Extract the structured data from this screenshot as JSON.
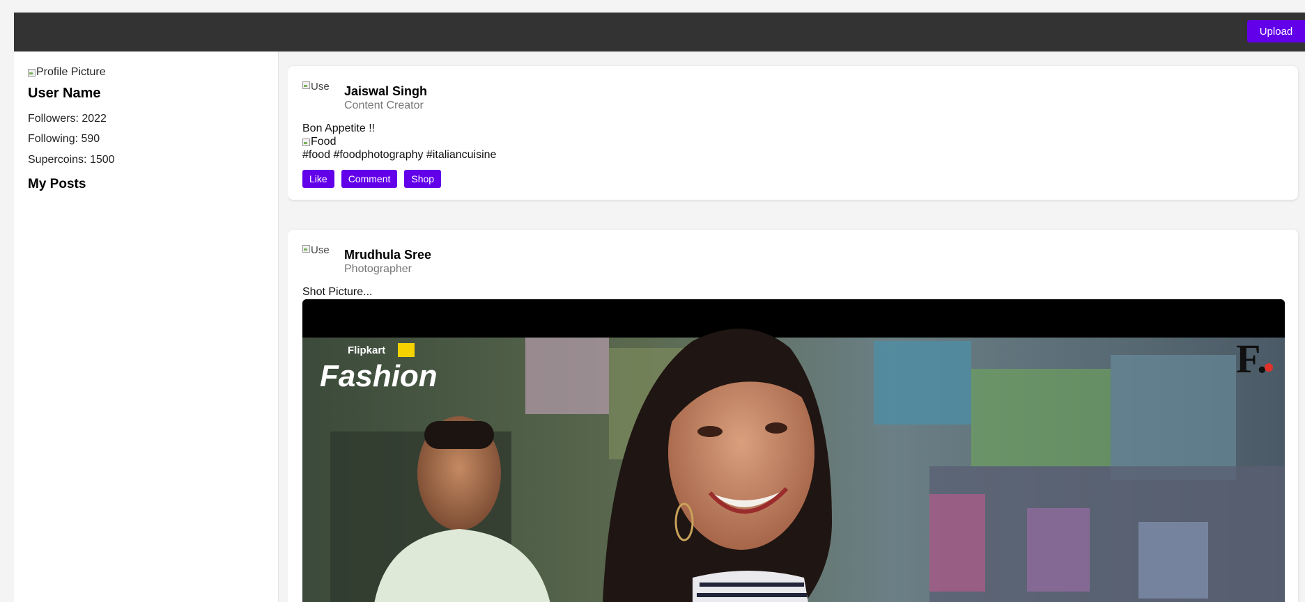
{
  "topbar": {
    "upload_label": "Upload"
  },
  "sidebar": {
    "profile_picture_alt": "Profile Picture",
    "username": "User Name",
    "followers": "Followers: 2022",
    "following": "Following: 590",
    "supercoins": "Supercoins: 1500",
    "my_posts_heading": "My Posts"
  },
  "posts": [
    {
      "avatar_alt": "Use",
      "author": "Jaiswal Singh",
      "role": "Content Creator",
      "caption": "Bon Appetite !!",
      "image_alt": "Food",
      "tags": "#food #foodphotography #italiancuisine",
      "actions": [
        "Like",
        "Comment",
        "Shop"
      ]
    },
    {
      "avatar_alt": "Use",
      "author": "Mrudhula Sree",
      "role": "Photographer",
      "caption": "Shot Picture...",
      "photo": {
        "brand_small": "Flipkart",
        "title": "Fashion",
        "logo": "F."
      }
    }
  ],
  "colors": {
    "accent": "#6200ea",
    "topbar": "#333333"
  }
}
